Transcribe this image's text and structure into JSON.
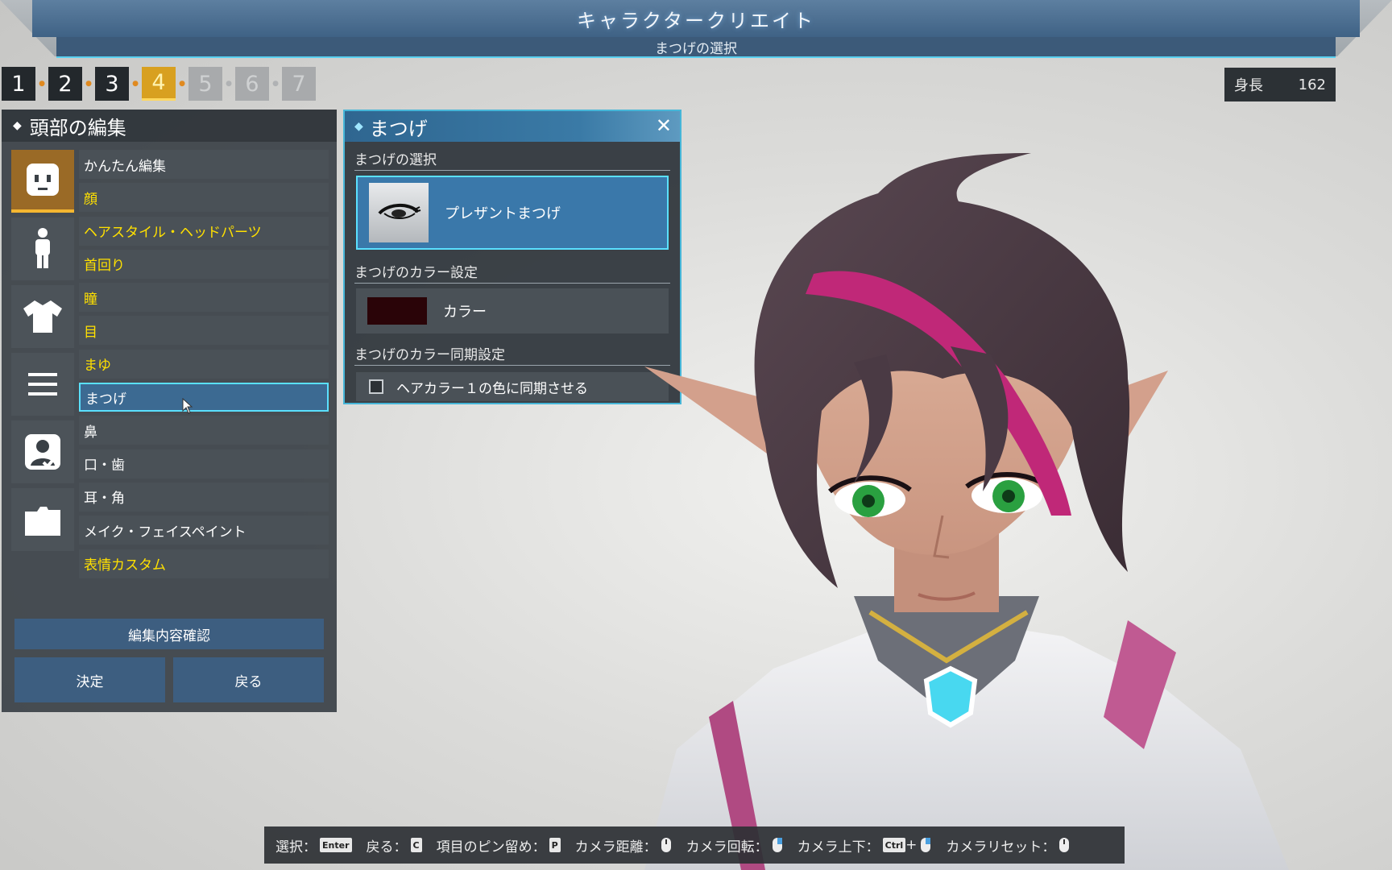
{
  "header": {
    "title": "キャラクタークリエイト",
    "subtitle": "まつげの選択"
  },
  "steps": [
    {
      "label": "1",
      "state": "done"
    },
    {
      "label": "2",
      "state": "done"
    },
    {
      "label": "3",
      "state": "done"
    },
    {
      "label": "4",
      "state": "active"
    },
    {
      "label": "5",
      "state": "disabled"
    },
    {
      "label": "6",
      "state": "disabled"
    },
    {
      "label": "7",
      "state": "disabled"
    }
  ],
  "height": {
    "label": "身長",
    "value": "162"
  },
  "left_panel": {
    "title": "頭部の編集",
    "categories": [
      {
        "icon": "face-icon",
        "active": true
      },
      {
        "icon": "body-icon",
        "active": false
      },
      {
        "icon": "shirt-icon",
        "active": false
      },
      {
        "icon": "menu-lines-icon",
        "active": false
      },
      {
        "icon": "profile-check-icon",
        "active": false
      },
      {
        "icon": "folder-icon",
        "active": false
      }
    ],
    "items": [
      {
        "label": "かんたん編集",
        "style": "white"
      },
      {
        "label": "顔",
        "style": "yellow"
      },
      {
        "label": "ヘアスタイル・ヘッドパーツ",
        "style": "yellow"
      },
      {
        "label": "首回り",
        "style": "yellow"
      },
      {
        "label": "瞳",
        "style": "yellow"
      },
      {
        "label": "目",
        "style": "yellow"
      },
      {
        "label": "まゆ",
        "style": "yellow"
      },
      {
        "label": "まつげ",
        "style": "selected"
      },
      {
        "label": "鼻",
        "style": "white"
      },
      {
        "label": "口・歯",
        "style": "white"
      },
      {
        "label": "耳・角",
        "style": "white"
      },
      {
        "label": "メイク・フェイスペイント",
        "style": "white"
      },
      {
        "label": "表情カスタム",
        "style": "yellow"
      }
    ],
    "confirm_label": "編集内容確認",
    "decide_label": "決定",
    "back_label": "戻る"
  },
  "popup": {
    "title": "まつげ",
    "select_section": "まつげの選択",
    "selected_lash": "プレザントまつげ",
    "color_section": "まつげのカラー設定",
    "color_label": "カラー",
    "color_value": "#2a0408",
    "sync_section": "まつげのカラー同期設定",
    "sync_label": "ヘアカラー１の色に同期させる",
    "sync_checked": false
  },
  "help_bar": [
    {
      "label": "選択：",
      "key": "Enter"
    },
    {
      "label": "戻る：",
      "key": "C"
    },
    {
      "label": "項目のピン留め：",
      "key": "P"
    },
    {
      "label": "カメラ距離：",
      "key": "mouse"
    },
    {
      "label": "カメラ回転：",
      "key": "mouse"
    },
    {
      "label": "カメラ上下：",
      "key": "Ctrl",
      "extra": "+mouse"
    },
    {
      "label": "カメラリセット：",
      "key": "mouse"
    }
  ],
  "colors": {
    "accent_cyan": "#5ae0ff",
    "highlight_yellow": "#ffe000",
    "panel_blue": "#3d5e80",
    "hair": "#4a3a44",
    "hair_streak": "#c02878",
    "eyes": "#2aa040"
  }
}
